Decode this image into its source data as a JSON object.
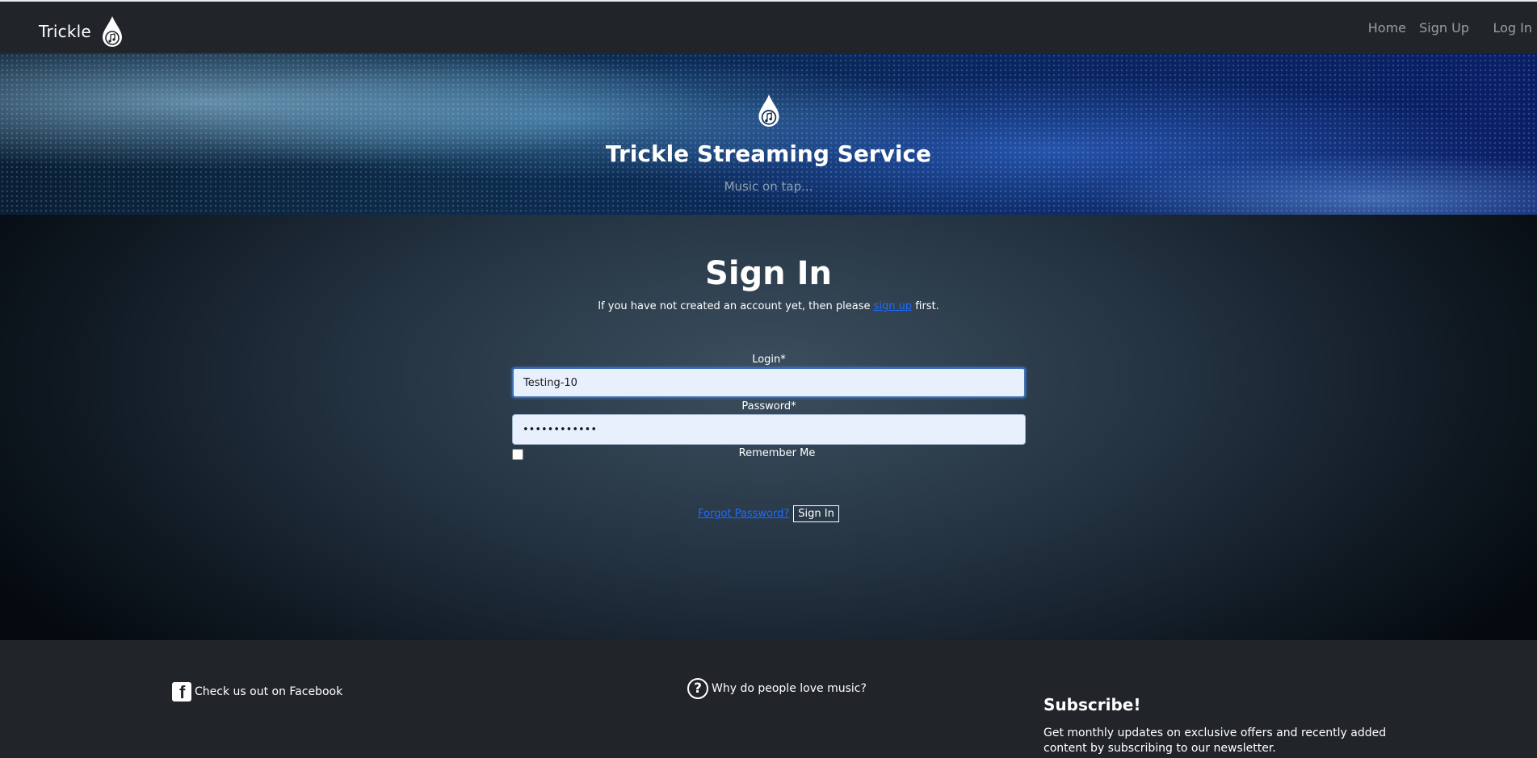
{
  "navbar": {
    "brand": "Trickle",
    "brand_icon": "music-drop-icon",
    "links": {
      "home": "Home",
      "signup": "Sign Up",
      "login": "Log In"
    }
  },
  "hero": {
    "icon": "music-drop-icon",
    "title": "Trickle Streaming Service",
    "subtitle": "Music on tap..."
  },
  "signin": {
    "title": "Sign In",
    "intro_before": "If you have not created an account yet, then please ",
    "intro_link": "sign up",
    "intro_after": " first.",
    "login_label": "Login*",
    "login_value": "Testing-10",
    "password_label": "Password*",
    "password_value": "••••••••••••",
    "remember_label": "Remember Me",
    "remember_checked": false,
    "forgot_link": "Forgot Password?",
    "submit_label": "Sign In"
  },
  "footer": {
    "facebook_text": "Check us out on Facebook",
    "facebook_icon": "facebook-icon",
    "music_text": "Why do people love music?",
    "music_icon": "question-circle-icon",
    "subscribe_title": "Subscribe!",
    "subscribe_text": "Get monthly updates on exclusive offers and recently added content by subscribing to our newsletter."
  },
  "colors": {
    "navbar_bg": "#212529",
    "link_blue": "#1e6cff",
    "input_bg": "#e8f0fe"
  }
}
